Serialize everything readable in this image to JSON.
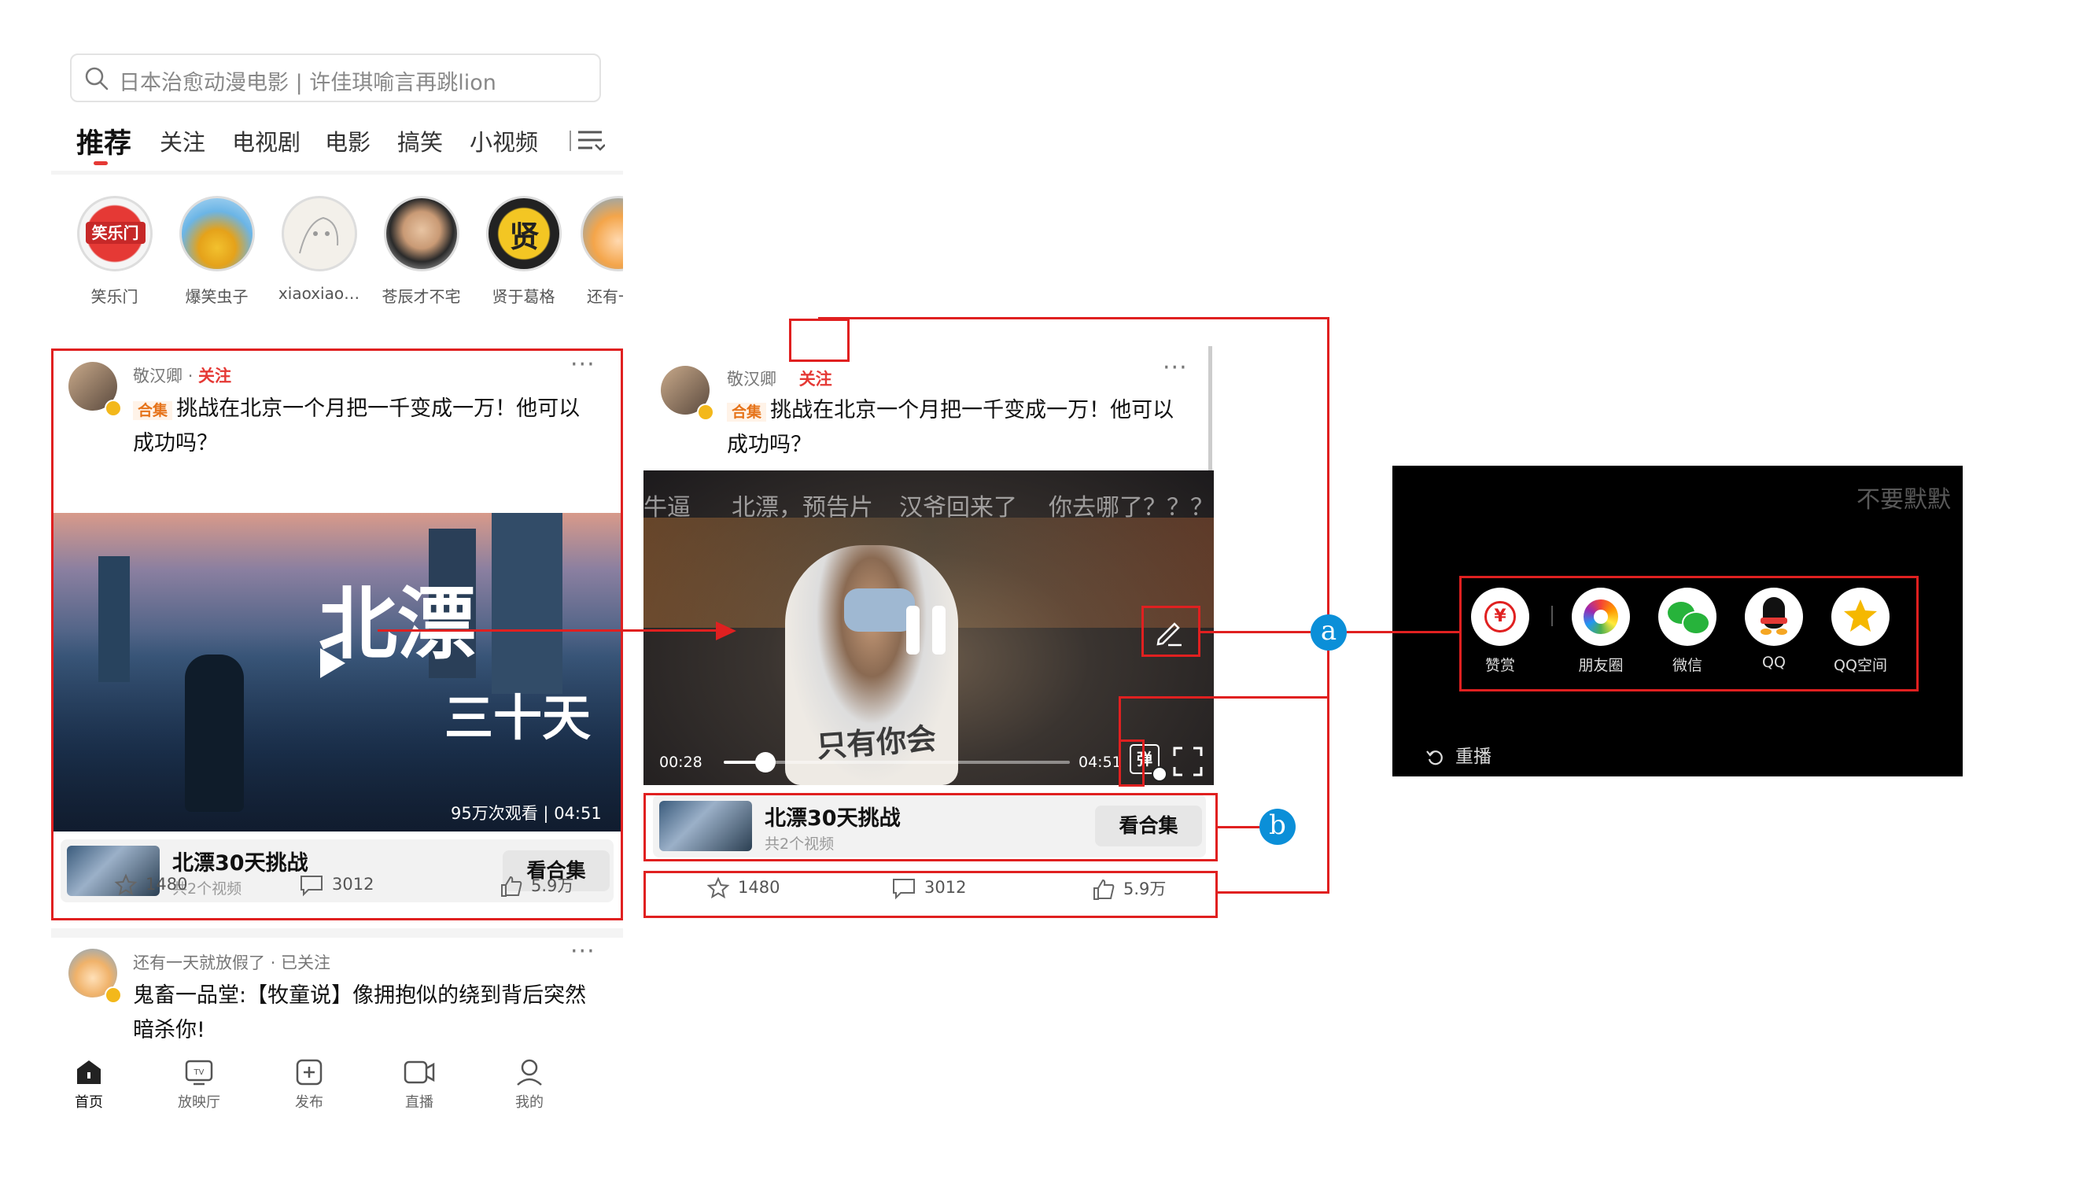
{
  "phone1": {
    "search": {
      "placeholder": "日本治愈动漫电影 | 许佳琪喻言再跳lion"
    },
    "tabs": [
      "推荐",
      "关注",
      "电视剧",
      "电影",
      "搞笑",
      "小视频"
    ],
    "stories": [
      "笑乐门",
      "爆笑虫子",
      "xiaoxiao…",
      "苍辰才不宅",
      "贤于葛格",
      "还有一"
    ],
    "story_logo_text": [
      "笑乐门",
      "贤"
    ],
    "card1": {
      "author": "敬汉卿",
      "follow": "关注",
      "tag": "合集",
      "title_line1": "挑战在北京一个月把一千变成一万！他可以",
      "title_line2": "成功吗？",
      "video_title_big": "北漂",
      "video_title_small": "三十天",
      "views": "95万次观看",
      "duration": "04:51",
      "collection": {
        "title": "北漂30天挑战",
        "subtitle": "共2个视频",
        "button": "看合集"
      },
      "actions": {
        "favorites": "1480",
        "comments": "3012",
        "likes": "5.9万"
      }
    },
    "card2": {
      "author": "还有一天就放假了",
      "followed": "已关注",
      "title_line1": "鬼畜一品堂:【牧童说】像拥抱似的绕到背后突然",
      "title_line2": "暗杀你!"
    },
    "bottom_nav": [
      "首页",
      "放映厅",
      "发布",
      "直播",
      "我的"
    ]
  },
  "phone2": {
    "author": "敬汉卿",
    "follow": "关注",
    "tag": "合集",
    "title_line1": "挑战在北京一个月把一千变成一万！他可以",
    "title_line2": "成功吗？",
    "danmaku": [
      "牛逼",
      "北漂，预告片",
      "汉爷回来了",
      "你去哪了？？？"
    ],
    "shirt_text": "只有你会",
    "time_current": "00:28",
    "time_total": "04:51",
    "danmu_btn": "弹",
    "progress": 0.12,
    "collection": {
      "title": "北漂30天挑战",
      "subtitle": "共2个视频",
      "button": "看合集"
    },
    "actions": {
      "favorites": "1480",
      "comments": "3012",
      "likes": "5.9万"
    }
  },
  "panel3": {
    "danmaku": "不要默默",
    "share_items": [
      "赞赏",
      "朋友圈",
      "微信",
      "QQ",
      "QQ空间"
    ],
    "reward_symbol": "¥",
    "replay": "重播"
  },
  "annotations": {
    "a": "a",
    "b": "b"
  },
  "colors": {
    "accent_red": "#e53935",
    "annotation_red": "#e02020",
    "badge_blue": "#0b8fd8"
  }
}
